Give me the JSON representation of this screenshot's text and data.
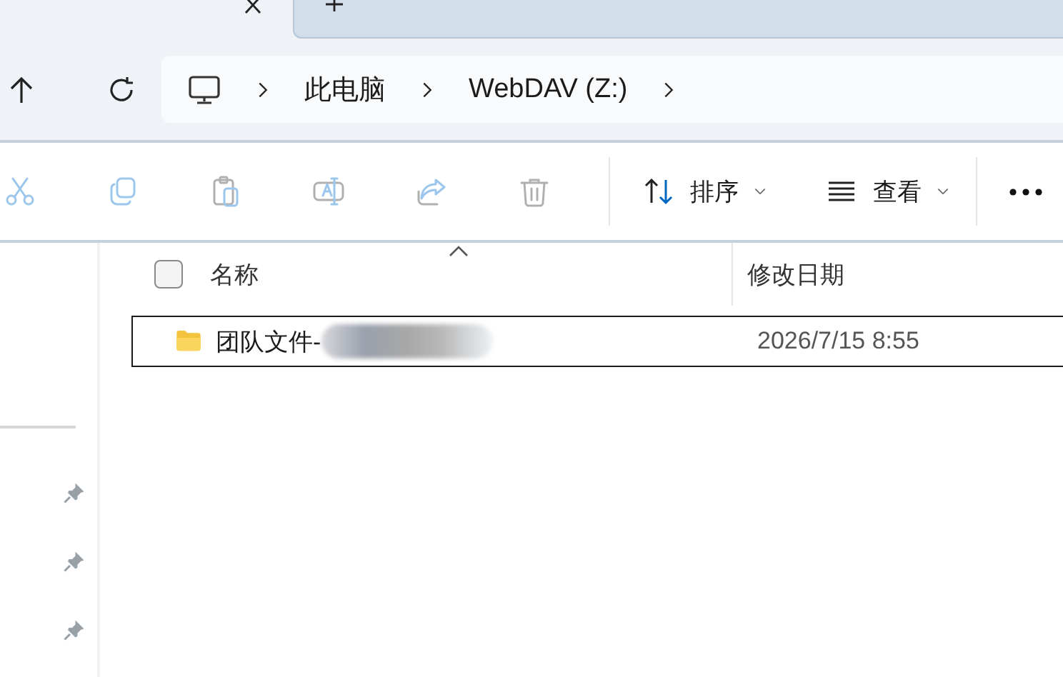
{
  "breadcrumbs": [
    {
      "label": "此电脑"
    },
    {
      "label": "WebDAV (Z:)"
    }
  ],
  "toolbar": {
    "actions": [
      {
        "kind": "cut",
        "disabled": true
      },
      {
        "kind": "copy",
        "disabled": true
      },
      {
        "kind": "paste",
        "disabled": true
      },
      {
        "kind": "rename",
        "disabled": true
      },
      {
        "kind": "share",
        "disabled": true
      },
      {
        "kind": "delete",
        "disabled": true
      }
    ],
    "sort": {
      "label": "排序"
    },
    "view": {
      "label": "查看"
    }
  },
  "table": {
    "select_all_checked": false,
    "columns": [
      {
        "label": "名称"
      },
      {
        "label": "修改日期"
      }
    ],
    "rows": [
      {
        "name": "团队文件-",
        "modified": "2026/7/15 8:55",
        "selected": true,
        "redacted": true
      }
    ]
  },
  "sidebar": {
    "items": [
      {
        "pinned": true
      },
      {
        "pinned": true
      },
      {
        "pinned": true
      }
    ]
  }
}
